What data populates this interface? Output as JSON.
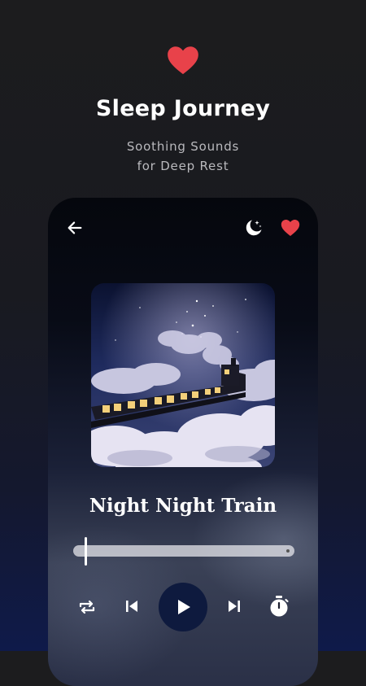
{
  "header": {
    "title": "Sleep Journey",
    "subtitle_line1": "Soothing Sounds",
    "subtitle_line2": "for Deep Rest"
  },
  "player": {
    "track_title": "Night Night Train",
    "progress": 0.0,
    "icons": [
      "back-arrow-icon",
      "moon-stars-icon",
      "heart-icon",
      "repeat-icon",
      "skip-previous-icon",
      "play-icon",
      "skip-next-icon",
      "timer-icon"
    ]
  },
  "colors": {
    "heart": "#e8424a",
    "play_button_bg": "#0e1a3e",
    "background_top": "#1c1c1e",
    "background_bottom": "#0f1a4a"
  }
}
